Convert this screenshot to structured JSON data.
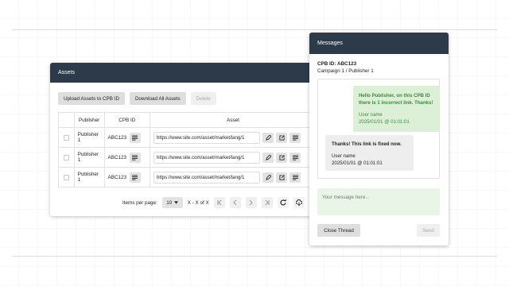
{
  "assets": {
    "title": "Assets",
    "toolbar": {
      "upload_label": "Upload Assets to CPB ID",
      "download_label": "Download All Assets",
      "delete_label": "Delete"
    },
    "columns": [
      "Publisher",
      "CPB ID",
      "Asset"
    ],
    "rows": [
      {
        "publisher": "Publisher 1",
        "cpb_id": "ABC123",
        "asset": "https://www.site.com/asset/market/lang/1"
      },
      {
        "publisher": "Publisher 1",
        "cpb_id": "ABC123",
        "asset": "https://www.site.com/asset/market/lang/1"
      },
      {
        "publisher": "Publisher 1",
        "cpb_id": "ABC123",
        "asset": "https://www.site.com/asset/market/lang/1"
      }
    ],
    "pager": {
      "items_label": "Items per page:",
      "per_page": "10",
      "range": "X - X of X"
    }
  },
  "messages": {
    "title": "Messages",
    "cpb_line": "CPB ID: ABC123",
    "campaign_line": "Campaign 1 / Publisher 1",
    "outgoing": {
      "text": "Hello Publisher, on this CPB ID there is 1 incorrect link. Thanks!",
      "user": "User name",
      "time": "2025/01/01 @ 01:01:01"
    },
    "incoming": {
      "text": "Thanks! This link is fixed now.",
      "user": "User name",
      "time": "2025/01/01 @ 01:01:01"
    },
    "compose_placeholder": "Your message here...",
    "close_label": "Close Thread",
    "send_label": "Send"
  },
  "colors": {
    "header": "#2d3a4a",
    "outgoing_bubble": "#dcf0d8",
    "outgoing_text": "#3d8a3a",
    "incoming_bubble": "#eeeeee",
    "compose_bg": "#e9f6e7"
  }
}
